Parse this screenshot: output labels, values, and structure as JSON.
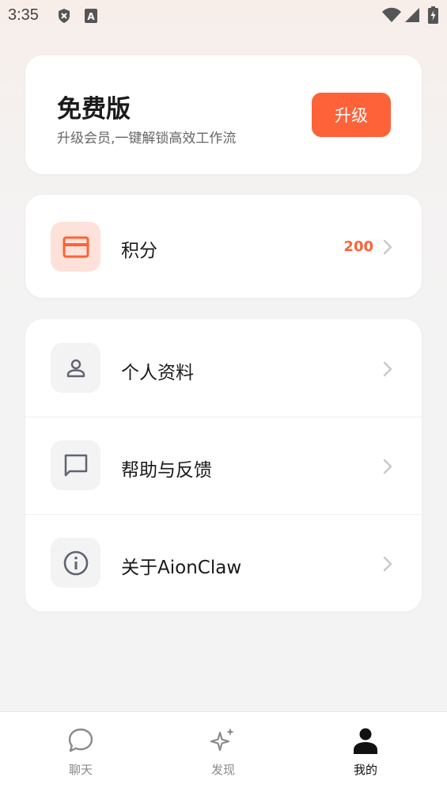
{
  "status_bar": {
    "time": "3:35"
  },
  "plan": {
    "title": "免费版",
    "subtitle": "升级会员,一键解锁高效工作流",
    "upgrade_label": "升级"
  },
  "points": {
    "label": "积分",
    "value": "200"
  },
  "menu": {
    "items": [
      {
        "label": "个人资料",
        "icon": "person-icon"
      },
      {
        "label": "帮助与反馈",
        "icon": "chat-bubble-icon"
      },
      {
        "label": "关于AionClaw",
        "icon": "info-icon"
      }
    ]
  },
  "tabbar": {
    "tabs": [
      {
        "label": "聊天",
        "icon": "chat-icon",
        "active": false
      },
      {
        "label": "发现",
        "icon": "sparkle-icon",
        "active": false
      },
      {
        "label": "我的",
        "icon": "profile-icon",
        "active": true
      }
    ]
  },
  "colors": {
    "accent": "#fe6239",
    "accent_light": "#fee2d9",
    "icon_gray": "#5f6470"
  }
}
